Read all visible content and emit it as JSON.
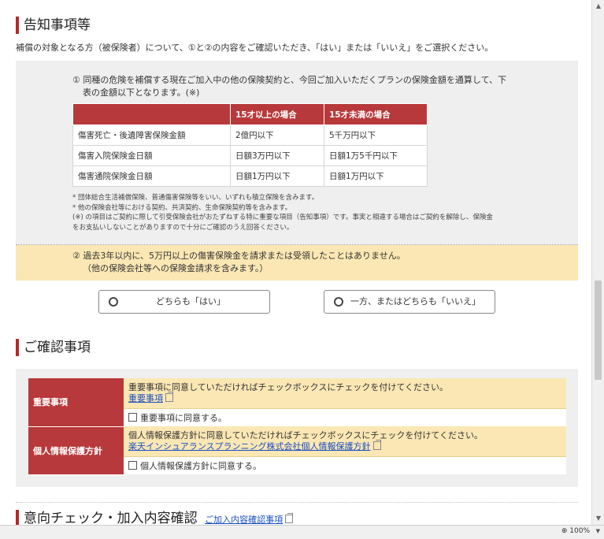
{
  "notice": {
    "title": "告知事項等",
    "intro": "補償の対象となる方（被保険者）について、①と②の内容をご確認いただき、「はい」または「いいえ」をご選択ください。",
    "q1_line1": "① 同種の危険を補償する現在ご加入中の他の保険契約と、今回ご加入いただくプランの保険金額を通算して、下",
    "q1_line2": "表の金額以下となります。(※)",
    "table": {
      "headers": [
        "",
        "15才以上の場合",
        "15才未満の場合"
      ],
      "rows": [
        [
          "傷害死亡・後遺障害保険金額",
          "2億円以下",
          "5千万円以下"
        ],
        [
          "傷害入院保険金日額",
          "日額3万円以下",
          "日額1万5千円以下"
        ],
        [
          "傷害通院保険金日額",
          "日額1万円以下",
          "日額1万円以下"
        ]
      ]
    },
    "notes": [
      "* 団体総合生活補償保険、普通傷害保険等をいい、いずれも積立保険を含みます。",
      "* 他の保険会社等における契約、共済契約、生命保険契約等を含みます。",
      "(※) の項目はご契約に際して引受保険会社がおたずねする特に重要な項目（告知事項）です。事実と相違する場合はご契約を解除し、保険金",
      "をお支払いしないことがありますので十分にご確認のうえ回答ください。"
    ],
    "q2_line1": "② 過去3年以内に、5万円以上の傷害保険金を請求または受領したことはありません。",
    "q2_line2": "（他の保険会社等への保険金請求を含みます。）",
    "choice_yes": "どちらも「はい」",
    "choice_no": "一方、またはどちらも「いいえ」"
  },
  "confirm": {
    "title": "ご確認事項",
    "items": [
      {
        "head": "重要事項",
        "desc": "重要事項に同意していただければチェックボックスにチェックを付けてください。",
        "link": "重要事項",
        "check": "重要事項に同意する。"
      },
      {
        "head": "個人情報保護方針",
        "desc": "個人情報保護方針に同意していただければチェックボックスにチェックを付けてください。",
        "link": "楽天インシュアランスプランニング株式会社個人情報保護方針",
        "check": "個人情報保護方針に同意する。"
      }
    ]
  },
  "intent": {
    "title": "意向チェック・加入内容確認",
    "link": "ご加入内容確認事項"
  },
  "statusbar": {
    "zoom": "100%"
  },
  "colors": {
    "accent_red": "#b8393b",
    "highlight_yellow": "#fbe7b4",
    "link_blue": "#1a4fc4"
  }
}
